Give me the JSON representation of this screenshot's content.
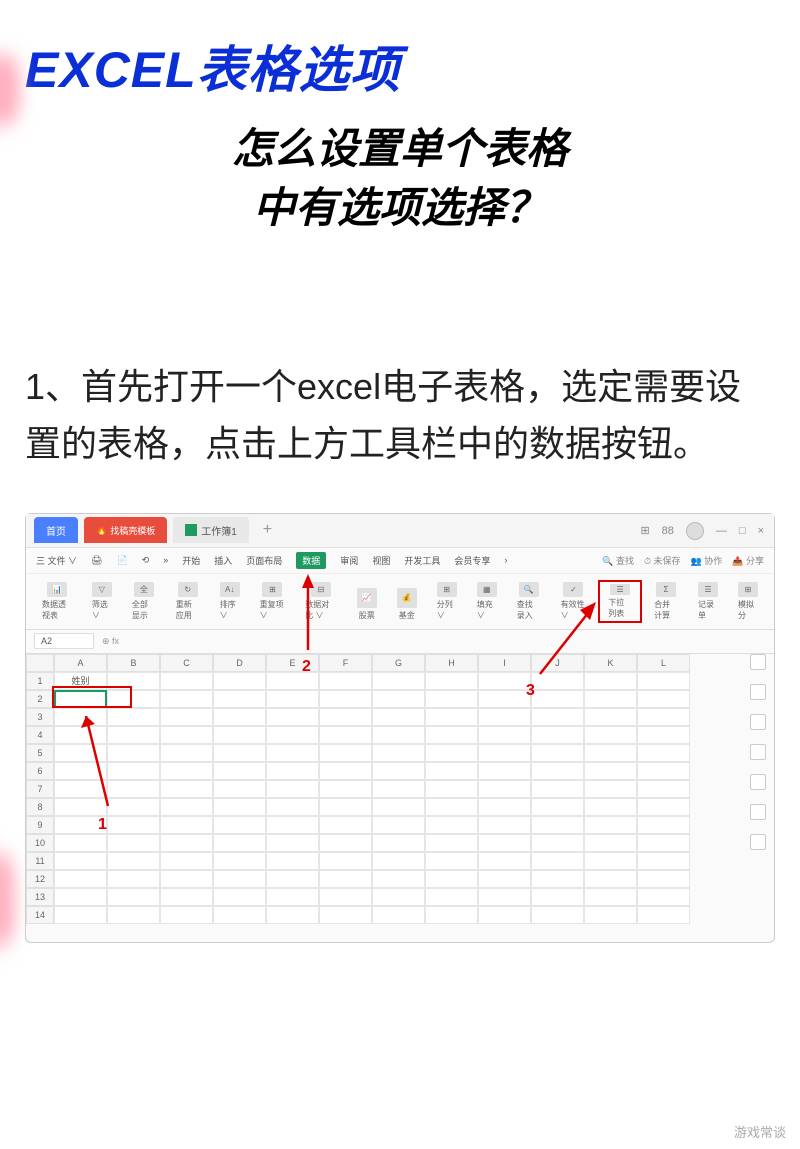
{
  "header": {
    "title_main": "EXCEL表格选项",
    "title_sub_line1": "怎么设置单个表格",
    "title_sub_line2": "中有选项选择？"
  },
  "step": {
    "text": "1、首先打开一个excel电子表格，选定需要设置的表格，点击上方工具栏中的数据按钮。"
  },
  "app": {
    "tabs": {
      "home": "首页",
      "template": "找稿壳模板",
      "file": "工作簿1",
      "plus": "+"
    },
    "window_icons": [
      "⊞",
      "88",
      "👤",
      "—",
      "□",
      "×"
    ],
    "menu": {
      "file": "三 文件 ∨",
      "items_left": [
        "🖨",
        "📄",
        "⟲"
      ],
      "arrow": "»",
      "tabs": [
        "开始",
        "插入",
        "页面布局"
      ],
      "active_tab": "数据",
      "tabs_after": [
        "审阅",
        "视图",
        "开发工具",
        "会员专享"
      ],
      "right_items": [
        "查找",
        "⏱ 未保存",
        "协作",
        "分享"
      ]
    },
    "toolbar": [
      {
        "label": "数据透视表",
        "icon": "📊"
      },
      {
        "label": "筛选 ∨",
        "icon": "▽"
      },
      {
        "label": "全部显示",
        "icon": "全"
      },
      {
        "label": "重新应用",
        "icon": "↻"
      },
      {
        "label": "排序 ∨",
        "icon": "A↓"
      },
      {
        "label": "重复项 ∨",
        "icon": "⊞"
      },
      {
        "label": "数据对比 ∨",
        "icon": "⊟"
      },
      {
        "label": "股票",
        "icon": "📈"
      },
      {
        "label": "基金",
        "icon": "💰"
      },
      {
        "label": "分列 ∨",
        "icon": "⊞"
      },
      {
        "label": "填充 ∨",
        "icon": "▦"
      },
      {
        "label": "查找录入",
        "icon": "🔍"
      },
      {
        "label": "有效性 ∨",
        "icon": "✓"
      },
      {
        "label": "下拉列表",
        "icon": "☰",
        "highlighted": true
      },
      {
        "label": "合并计算",
        "icon": "Σ"
      },
      {
        "label": "记录单",
        "icon": "☰"
      },
      {
        "label": "模拟分",
        "icon": "⊞"
      }
    ],
    "cell_ref": "A2",
    "fx_label": "⊕ fx",
    "columns": [
      "A",
      "B",
      "C",
      "D",
      "E",
      "F",
      "G",
      "H",
      "I",
      "J",
      "K",
      "L"
    ],
    "rows": [
      "1",
      "2",
      "3",
      "4",
      "5",
      "6",
      "7",
      "8",
      "9",
      "10",
      "11",
      "12",
      "13",
      "14"
    ],
    "cell_a1": "姓别",
    "annotations": {
      "step1": "1",
      "step2": "2",
      "step3": "3"
    }
  },
  "watermark": "游戏常谈"
}
